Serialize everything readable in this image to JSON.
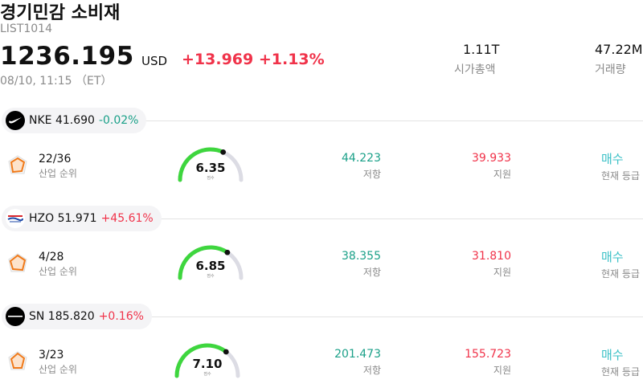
{
  "header": {
    "title": "경기민감 소비재",
    "code": "LIST1014",
    "price": "1236.195",
    "currency": "USD",
    "change": "+13.969 +1.13%",
    "timestamp": "08/10, 11:15 （ET）",
    "market_cap_value": "1.11T",
    "market_cap_label": "시가총액",
    "volume_value": "47.22M",
    "volume_label": "거래량"
  },
  "colors": {
    "up": "#f0334a",
    "down": "#1aa088",
    "signal": "#3cc1c7",
    "gauge": "#3ed63e",
    "radar": "#f07a1a"
  },
  "stocks": [
    {
      "ticker_price": "NKE 41.690",
      "change": "-0.02%",
      "direction": "down",
      "logo": "nike-swoosh-logo",
      "rank": "22/36",
      "rank_label": "산업 순위",
      "score": "6.35",
      "score_fraction": 0.635,
      "score_label": "점수",
      "resistance": "44.223",
      "resistance_label": "저항",
      "support": "39.933",
      "support_label": "지원",
      "signal": "매수",
      "signal_label": "현재 등급"
    },
    {
      "ticker_price": "HZO 51.971",
      "change": "+45.61%",
      "direction": "up",
      "logo": "marinemax-logo",
      "rank": "4/28",
      "rank_label": "산업 순위",
      "score": "6.85",
      "score_fraction": 0.685,
      "score_label": "점수",
      "resistance": "38.355",
      "resistance_label": "저항",
      "support": "31.810",
      "support_label": "지원",
      "signal": "매수",
      "signal_label": "현재 등급"
    },
    {
      "ticker_price": "SN 185.820",
      "change": "+0.16%",
      "direction": "up",
      "logo": "sharkninja-logo",
      "rank": "3/23",
      "rank_label": "산업 순위",
      "score": "7.10",
      "score_fraction": 0.71,
      "score_label": "점수",
      "resistance": "201.473",
      "resistance_label": "저항",
      "support": "155.723",
      "support_label": "지원",
      "signal": "매수",
      "signal_label": "현재 등급"
    }
  ]
}
